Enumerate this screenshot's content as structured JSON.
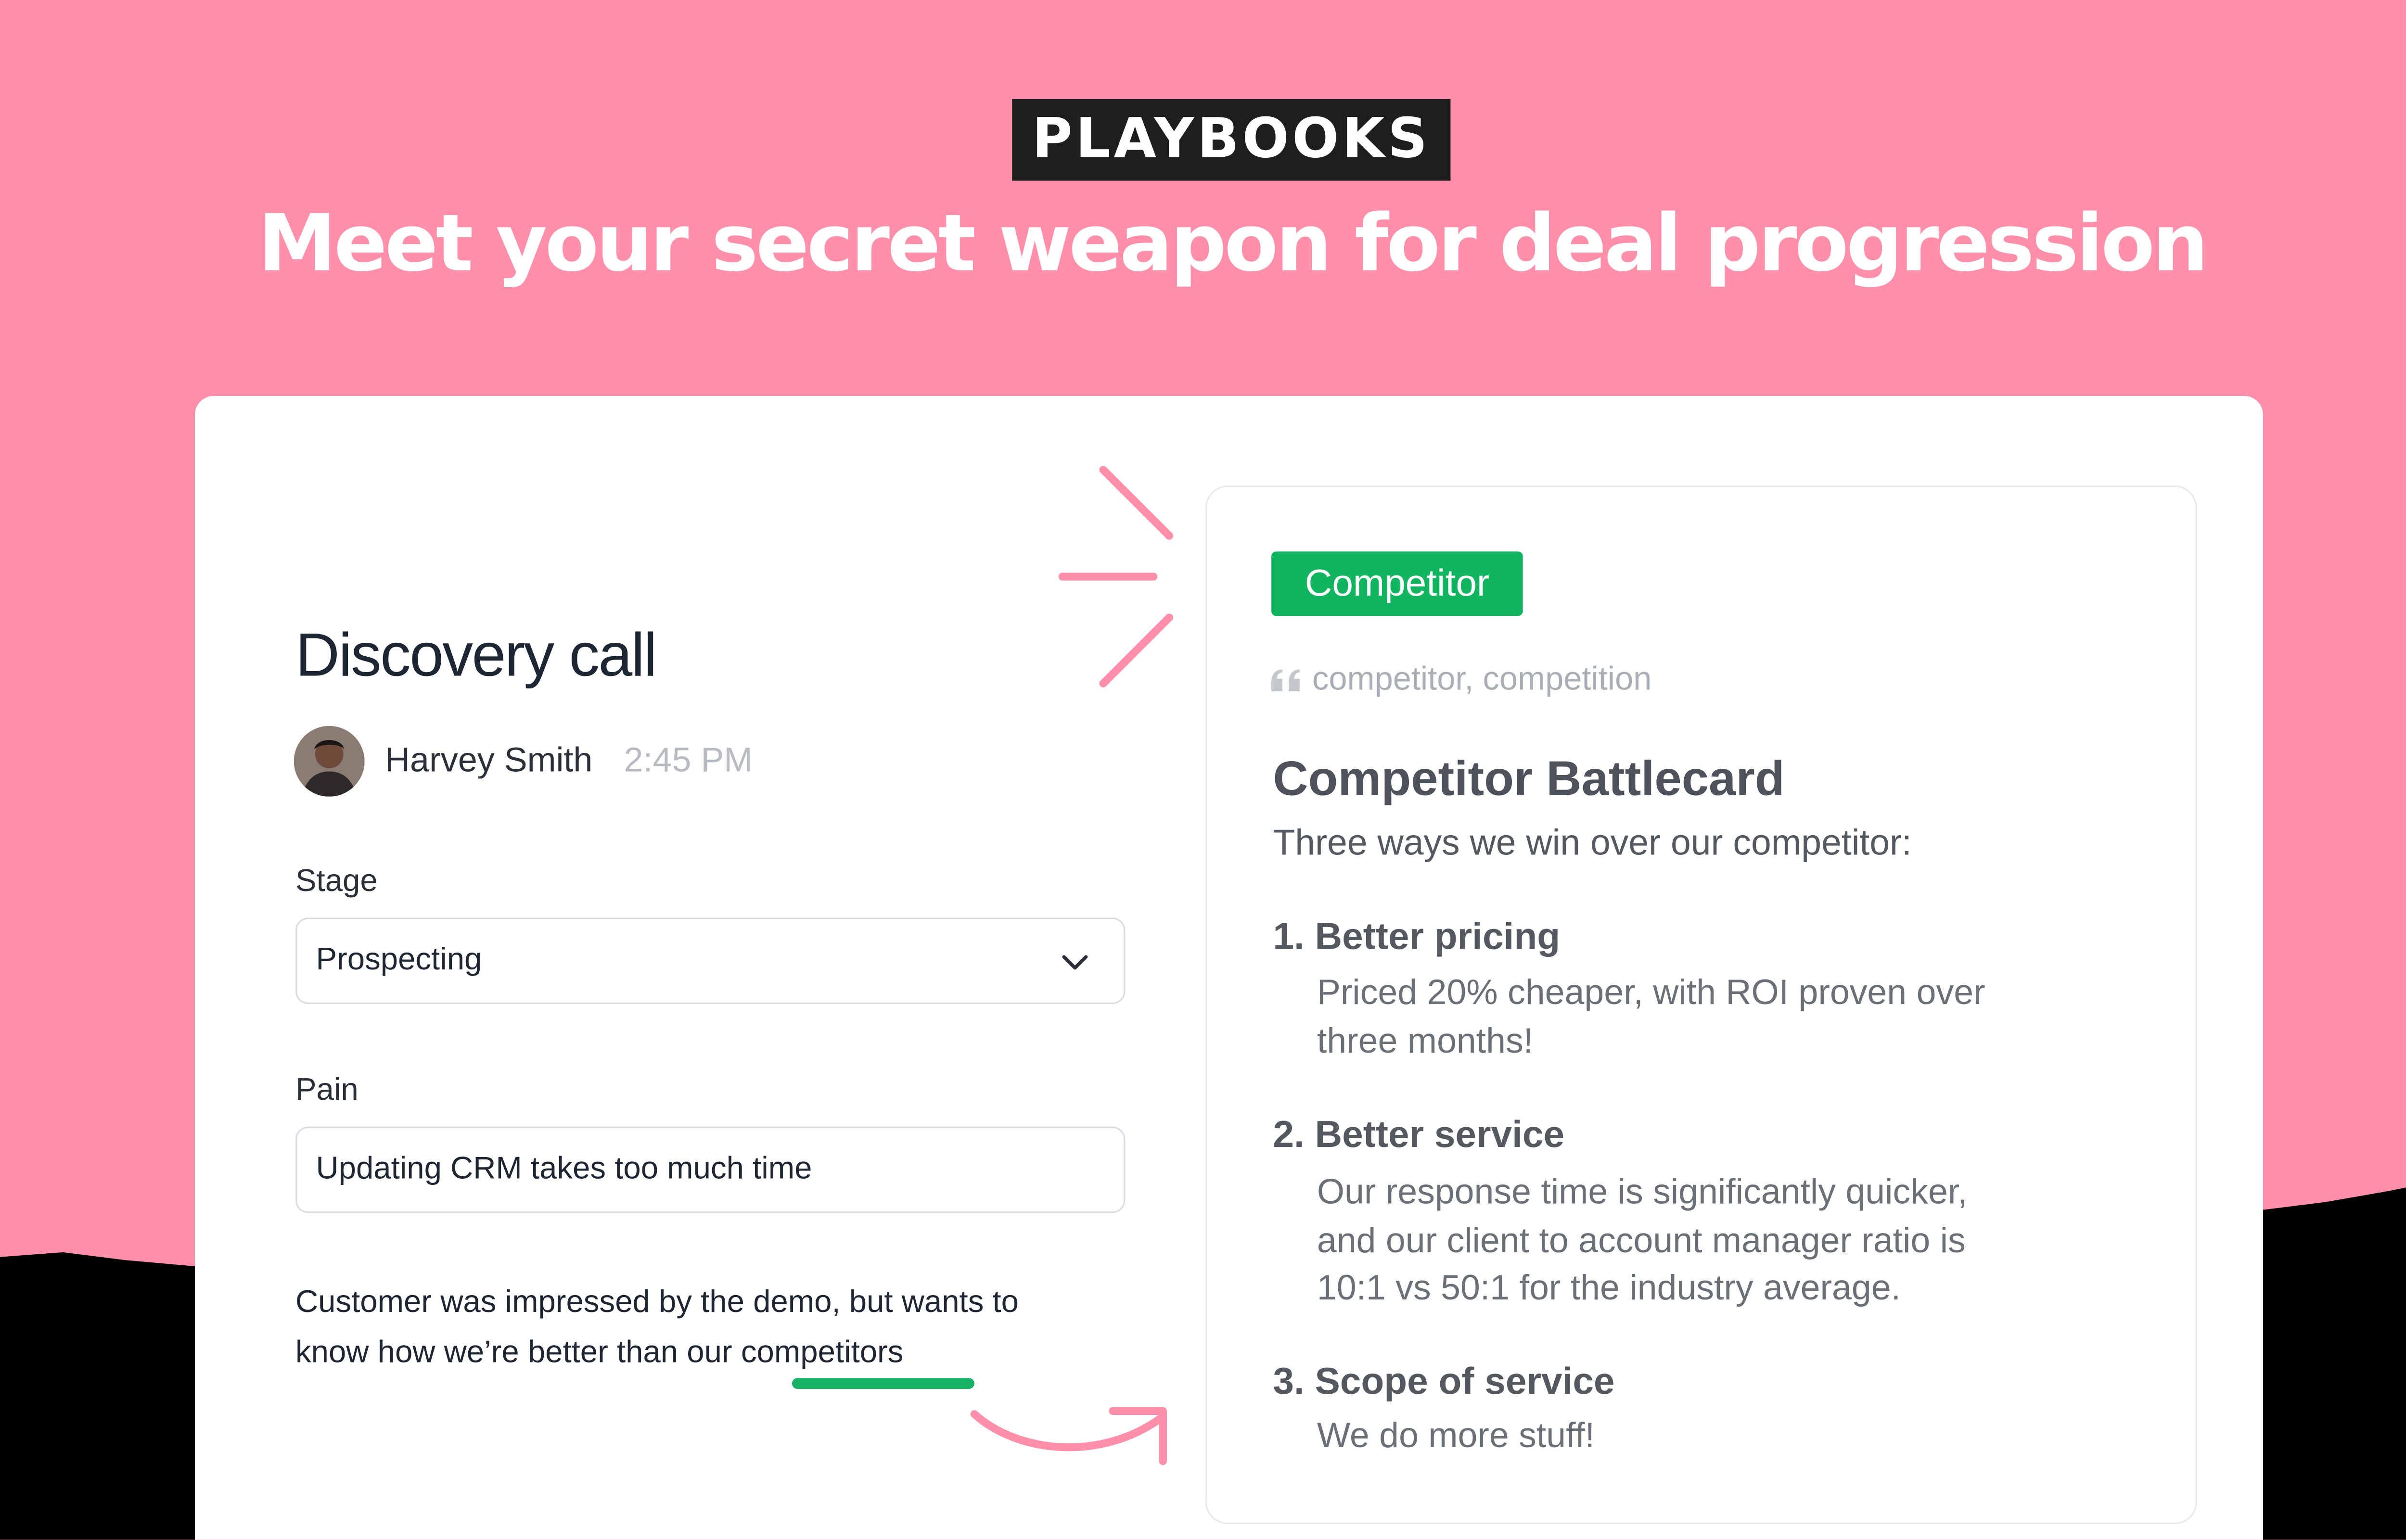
{
  "banner": {
    "label": "PLAYBOOKS",
    "headline": "Meet your secret weapon for deal progression"
  },
  "call": {
    "title": "Discovery call",
    "author": "Harvey Smith",
    "time": "2:45 PM",
    "stage": {
      "label": "Stage",
      "value": "Prospecting"
    },
    "pain": {
      "label": "Pain",
      "value": "Updating CRM takes too much time"
    },
    "note": {
      "line1": "Customer was impressed by the demo, but wants to",
      "line2_prefix": "know how we’re better than our ",
      "keyword": "competitors"
    }
  },
  "battlecard": {
    "tag": "Competitor",
    "keywords": "competitor, competition",
    "title": "Competitor Battlecard",
    "subtitle": "Three ways we win over our competitor:",
    "items": [
      {
        "title": "1. Better pricing",
        "lines": [
          "Priced 20% cheaper, with ROI proven over",
          "three months!"
        ]
      },
      {
        "title": "2. Better service",
        "lines": [
          "Our response time is significantly quicker,",
          "and our client to account manager ratio is",
          "10:1 vs 50:1 for the industry average."
        ]
      },
      {
        "title": "3. Scope of service",
        "lines": [
          "We do more stuff!"
        ]
      }
    ]
  },
  "colors": {
    "background": "#ff8fab",
    "accent_green": "#12b55f",
    "dark": "#1e1e1e"
  },
  "icons": [
    "quote-icon",
    "chevron-down-icon",
    "sparkle-lines-icon",
    "curved-arrow-icon"
  ]
}
